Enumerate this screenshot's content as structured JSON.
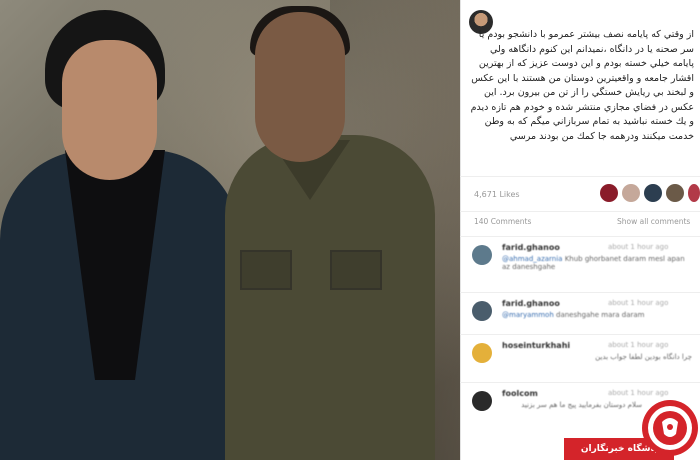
{
  "post": {
    "caption": "از وقتي كه پايامه نصف بيشتر عمرمو با دانشجو بودم يا سر صحنه يا در دانگاه ،نميدانم اين كنوم دانگاهه ولي پايامه خيلي خسته بودم و اين دوست عزيز كه از بهترين اقشار جامعه و واقعيترين دوستان من هستند با اين عكس و لبخند بي ريايش خستگي را از تن من بيرون برد. اين عكس در فضاي مجازي منتشر شده و خودم هم تازه ديدم و يك خسته نباشيد به تمام سربازاني ميگم كه به وطن خدمت ميكنند ودرهمه جا كمك من بودند مرسي",
    "likes": "4,671 Likes",
    "comments_count": "140 Comments",
    "show_all": "Show all comments"
  },
  "comments": [
    {
      "user": "farid.ghanoo",
      "time": "about 1 hour ago",
      "text_link": "@ahmad_azarnia",
      "text": " Khub ghorbanet daram mesl apan az daneshgahe"
    },
    {
      "user": "farid.ghanoo",
      "time": "about 1 hour ago",
      "text_link": "@maryammoh",
      "text": " daneshgahe mara daram"
    },
    {
      "user": "hoseinturkhahi",
      "time": "about 1 hour ago",
      "text_link": "",
      "text": "چرا دانگاه بودين لطفا جواب بدين"
    },
    {
      "user": "foolcom",
      "time": "about 1 hour ago",
      "text_link": "",
      "text": "سلام دوستان بفرماييد پيج ما هم سر بزنيد"
    }
  ],
  "watermark": {
    "label": "باشگاه خبرنگاران"
  },
  "colors": {
    "watermark_red": "#d4242a",
    "link_blue": "#3a6fb0"
  }
}
